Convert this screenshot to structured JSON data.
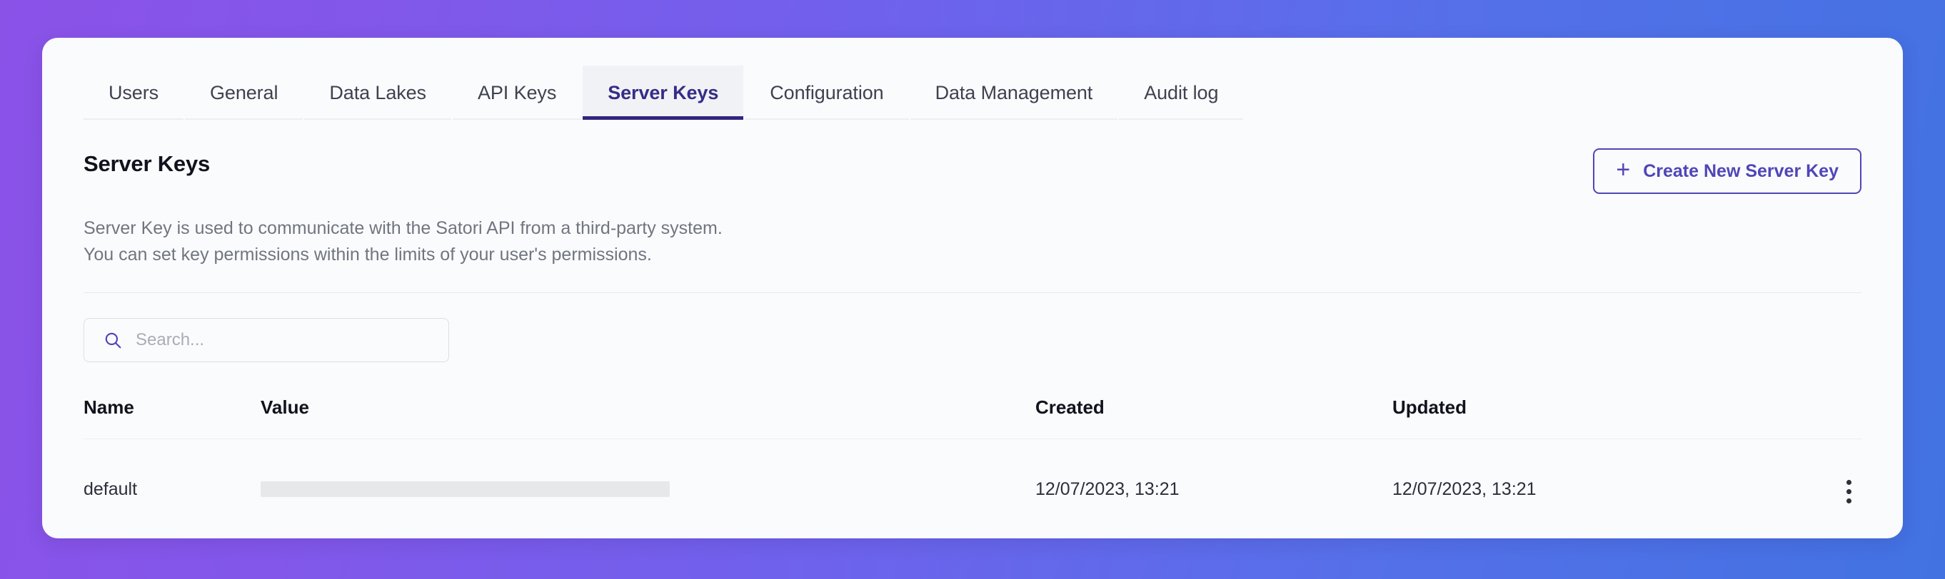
{
  "theme": {
    "gradient_start": "#8B52E8",
    "gradient_end": "#4272E2",
    "card_background": "#FAFBFD",
    "accent": "#4F46B8",
    "active_tab_underline": "#30267F"
  },
  "tabs": [
    {
      "label": "Users",
      "active": false
    },
    {
      "label": "General",
      "active": false
    },
    {
      "label": "Data Lakes",
      "active": false
    },
    {
      "label": "API Keys",
      "active": false
    },
    {
      "label": "Server Keys",
      "active": true
    },
    {
      "label": "Configuration",
      "active": false
    },
    {
      "label": "Data Management",
      "active": false
    },
    {
      "label": "Audit log",
      "active": false
    }
  ],
  "main": {
    "title": "Server Keys",
    "description_line1": "Server Key is used to communicate with the Satori API from a third-party system.",
    "description_line2": "You can set key permissions within the limits of your user's permissions.",
    "create_button": {
      "label": "Create New Server Key",
      "icon": "plus-icon",
      "icon_glyph": "+"
    },
    "search": {
      "placeholder": "Search...",
      "value": "",
      "icon": "search-icon"
    },
    "table": {
      "columns": [
        "Name",
        "Value",
        "Created",
        "Updated"
      ],
      "rows": [
        {
          "name": "default",
          "value": "",
          "value_masked": true,
          "created": "12/07/2023, 13:21",
          "updated": "12/07/2023, 13:21",
          "actions_icon": "kebab-menu-icon"
        }
      ]
    }
  }
}
